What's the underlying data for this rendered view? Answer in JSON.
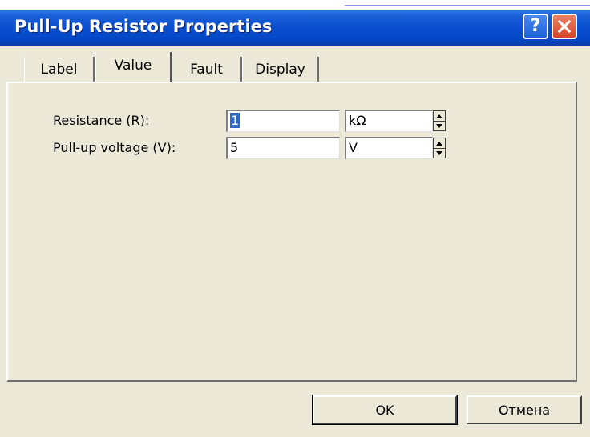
{
  "window": {
    "title": "Pull-Up Resistor Properties",
    "help_glyph": "?",
    "close_icon": "close-icon"
  },
  "tabs": [
    {
      "label": "Label",
      "active": false
    },
    {
      "label": "Value",
      "active": true
    },
    {
      "label": "Fault",
      "active": false
    },
    {
      "label": "Display",
      "active": false
    }
  ],
  "fields": {
    "resistance": {
      "label": "Resistance (R):",
      "value": "1",
      "unit": "kΩ"
    },
    "voltage": {
      "label": "Pull-up voltage (V):",
      "value": "5",
      "unit": "V"
    }
  },
  "buttons": {
    "ok": "OK",
    "cancel": "Отмена"
  },
  "colors": {
    "titlebar": "#0a4fd0",
    "dialog_bg": "#ece9d8",
    "close_button": "#d8452a",
    "selection": "#316ac5"
  }
}
